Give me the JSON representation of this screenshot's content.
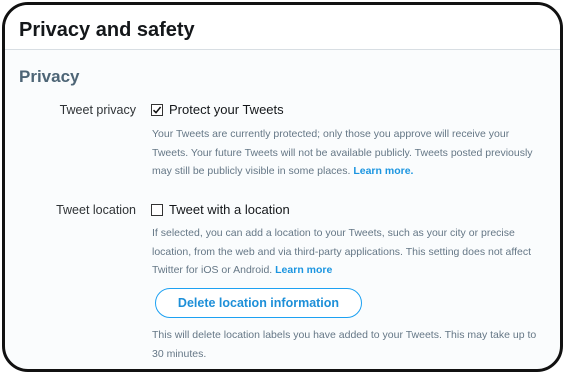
{
  "header": {
    "title": "Privacy and safety"
  },
  "privacy": {
    "section_title": "Privacy",
    "tweet_privacy": {
      "label": "Tweet privacy",
      "checkbox_label": "Protect your Tweets",
      "checked": true,
      "description": "Your Tweets are currently protected; only those you approve will receive your Tweets. Your future Tweets will not be available publicly. Tweets posted previously may still be publicly visible in some places.",
      "learn_more": "Learn more."
    },
    "tweet_location": {
      "label": "Tweet location",
      "checkbox_label": "Tweet with a location",
      "checked": false,
      "description": "If selected, you can add a location to your Tweets, such as your city or precise location, from the web and via third-party applications. This setting does not affect Twitter for iOS or Android.",
      "learn_more": "Learn more",
      "delete_button": "Delete location information",
      "delete_note": "This will delete location labels you have added to your Tweets. This may take up to 30 minutes."
    }
  },
  "colors": {
    "accent": "#1da1f2",
    "link": "#1b95e0",
    "section": "#4d6576"
  }
}
